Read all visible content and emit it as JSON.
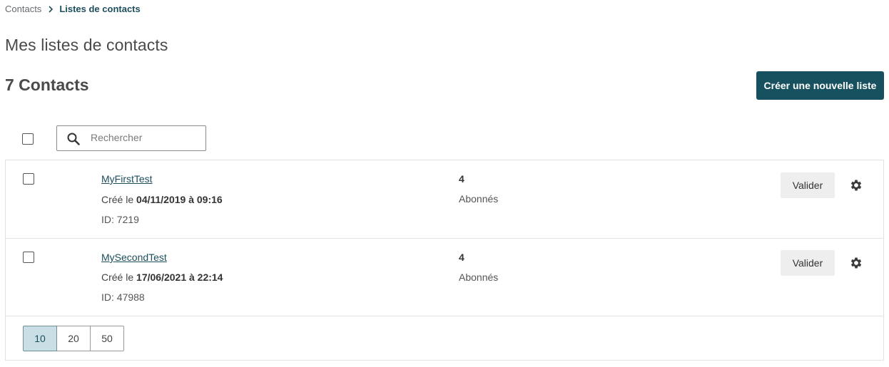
{
  "breadcrumb": {
    "root": "Contacts",
    "current": "Listes de contacts",
    "separator_icon": "chevron-right-icon"
  },
  "page_title": "Mes listes de contacts",
  "count_title": "7 Contacts",
  "create_button": "Créer une nouvelle liste",
  "search": {
    "placeholder": "Rechercher",
    "value": ""
  },
  "lists": [
    {
      "name": "MyFirstTest",
      "created_prefix": "Créé le",
      "created_date": "04/11/2019 à 09:16",
      "id_label": "ID: 7219",
      "count": "4",
      "count_label": "Abonnés",
      "validate_label": "Valider"
    },
    {
      "name": "MySecondTest",
      "created_prefix": "Créé le",
      "created_date": "17/06/2021 à 22:14",
      "id_label": "ID: 47988",
      "count": "4",
      "count_label": "Abonnés",
      "validate_label": "Valider"
    }
  ],
  "pagination": {
    "options": [
      "10",
      "20",
      "50"
    ],
    "selected": "10"
  },
  "colors": {
    "primary": "#17505e",
    "link": "#1c4e5c",
    "page_active_bg": "#c9dfe5",
    "button_secondary_bg": "#eeeeee"
  }
}
